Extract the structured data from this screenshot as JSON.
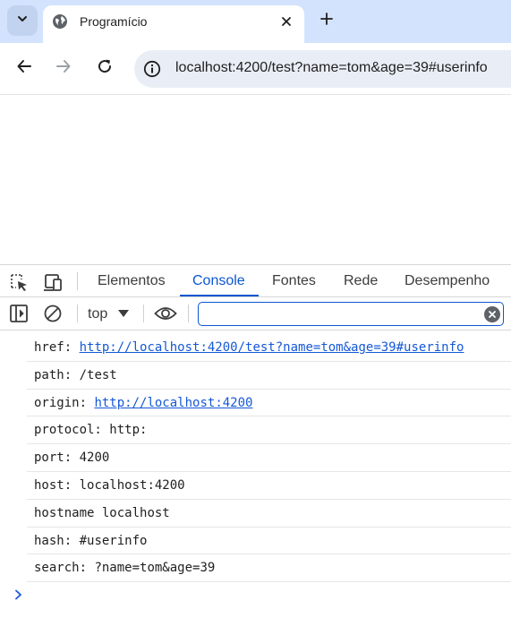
{
  "browser": {
    "tab": {
      "title": "Programício"
    },
    "address_bar": {
      "url": "localhost:4200/test?name=tom&age=39#userinfo"
    }
  },
  "devtools": {
    "tabs": [
      {
        "label": "Elementos",
        "active": false
      },
      {
        "label": "Console",
        "active": true
      },
      {
        "label": "Fontes",
        "active": false
      },
      {
        "label": "Rede",
        "active": false
      },
      {
        "label": "Desempenho",
        "active": false
      }
    ],
    "console_toolbar": {
      "context": "top",
      "filter_value": ""
    },
    "messages": [
      {
        "key": "href:",
        "value": "http://localhost:4200/test?name=tom&age=39#userinfo",
        "link": true
      },
      {
        "key": "path:",
        "value": "/test",
        "link": false
      },
      {
        "key": "origin:",
        "value": "http://localhost:4200",
        "link": true
      },
      {
        "key": "protocol:",
        "value": "http:",
        "link": false
      },
      {
        "key": "port:",
        "value": "4200",
        "link": false
      },
      {
        "key": "host:",
        "value": "localhost:4200",
        "link": false
      },
      {
        "key": "hostname",
        "value": "localhost",
        "link": false
      },
      {
        "key": "hash:",
        "value": "#userinfo",
        "link": false
      },
      {
        "key": "search:",
        "value": "?name=tom&age=39",
        "link": false
      }
    ]
  },
  "colors": {
    "tabstrip_bg": "#d3e3fd",
    "accent": "#0b57d0",
    "link": "#1558d6"
  },
  "icons": {
    "tab_search": "chevron-down-icon",
    "favicon": "globe-icon",
    "close": "close-icon",
    "new_tab": "plus-icon",
    "back": "arrow-left-icon",
    "forward": "arrow-right-icon",
    "reload": "reload-icon",
    "site_info": "info-icon",
    "inspect": "inspect-element-icon",
    "device": "device-toggle-icon",
    "sidebar": "sidebar-icon",
    "clear": "clear-console-icon",
    "dropdown": "caret-down-icon",
    "eye": "eye-icon",
    "filter_clear": "clear-filter-icon",
    "prompt": "chevron-right-icon"
  }
}
